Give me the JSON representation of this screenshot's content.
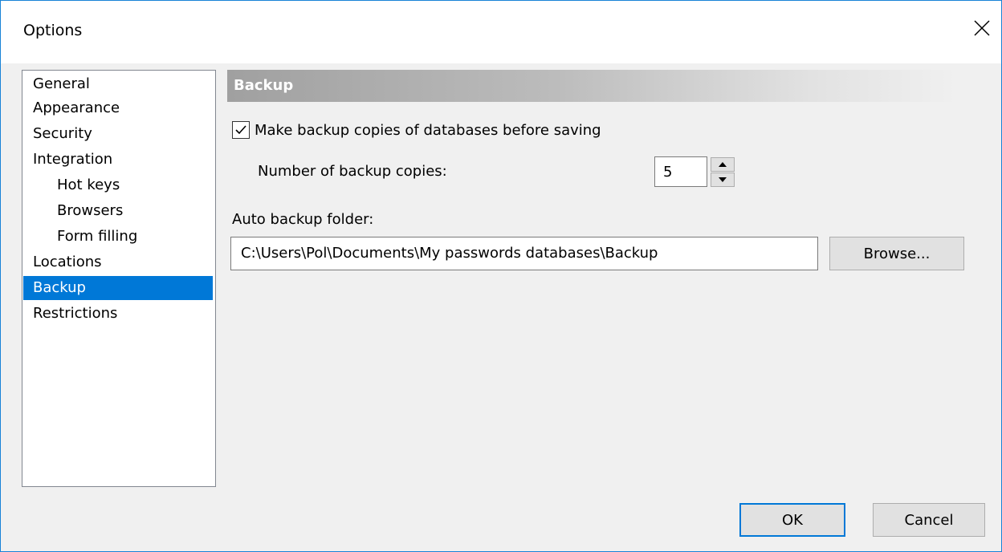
{
  "window": {
    "title": "Options"
  },
  "nav": {
    "items": [
      {
        "label": "General",
        "level": 0,
        "selected": false
      },
      {
        "label": "Appearance",
        "level": 0,
        "selected": false
      },
      {
        "label": "Security",
        "level": 0,
        "selected": false
      },
      {
        "label": "Integration",
        "level": 0,
        "selected": false
      },
      {
        "label": "Hot keys",
        "level": 1,
        "selected": false
      },
      {
        "label": "Browsers",
        "level": 1,
        "selected": false
      },
      {
        "label": "Form filling",
        "level": 1,
        "selected": false
      },
      {
        "label": "Locations",
        "level": 0,
        "selected": false
      },
      {
        "label": "Backup",
        "level": 0,
        "selected": true
      },
      {
        "label": "Restrictions",
        "level": 0,
        "selected": false
      }
    ]
  },
  "backup": {
    "header": "Backup",
    "make_copies_label": "Make backup copies of databases before saving",
    "make_copies_checked": true,
    "copies_label": "Number of backup copies:",
    "copies_value": "5",
    "folder_label": "Auto backup folder:",
    "folder_value": "C:\\Users\\Pol\\Documents\\My passwords databases\\Backup",
    "browse_label": "Browse..."
  },
  "footer": {
    "ok_label": "OK",
    "cancel_label": "Cancel"
  },
  "colors": {
    "selection": "#0078d7",
    "window_border": "#1883d7",
    "background": "#f0f0f0"
  }
}
